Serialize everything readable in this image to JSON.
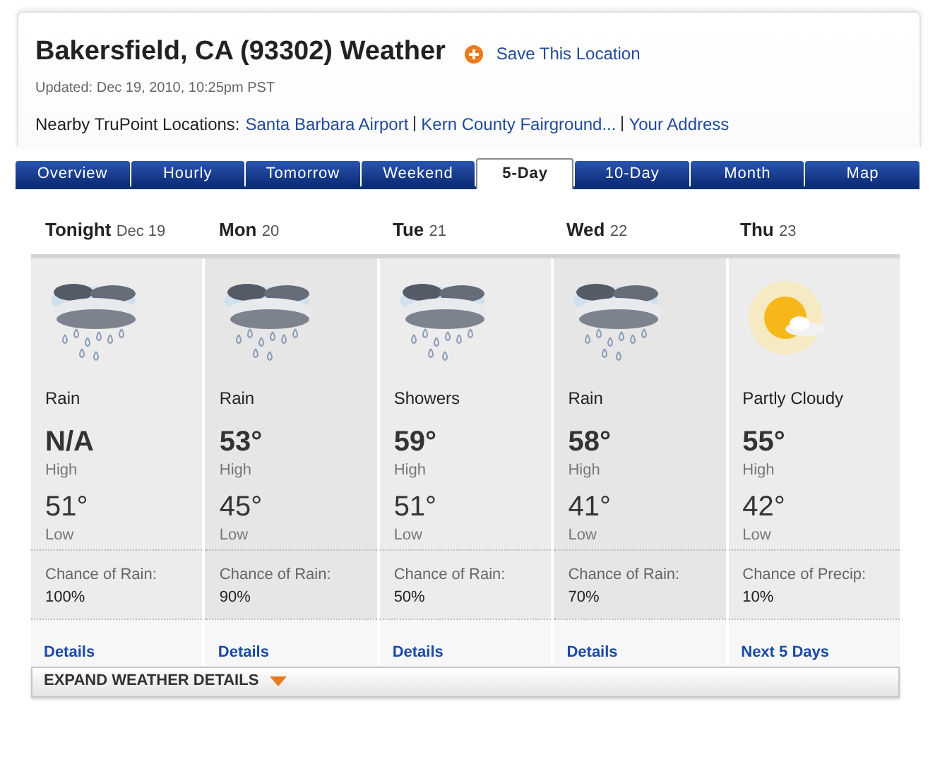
{
  "header": {
    "title": "Bakersfield, CA (93302) Weather",
    "save_link": "Save This Location",
    "updated": "Updated: Dec 19, 2010, 10:25pm PST",
    "nearby_label": "Nearby TruPoint Locations:",
    "nearby_links": [
      "Santa Barbara Airport",
      "Kern County Fairground...",
      "Your Address"
    ]
  },
  "tabs": [
    {
      "label": "Overview",
      "selected": false
    },
    {
      "label": "Hourly",
      "selected": false
    },
    {
      "label": "Tomorrow",
      "selected": false
    },
    {
      "label": "Weekend",
      "selected": false
    },
    {
      "label": "5-Day",
      "selected": true
    },
    {
      "label": "10-Day",
      "selected": false
    },
    {
      "label": "Month",
      "selected": false
    },
    {
      "label": "Map",
      "selected": false
    }
  ],
  "days": [
    {
      "day": "Tonight",
      "date": "Dec 19",
      "kind": "rain",
      "condition": "Rain",
      "high": "N/A",
      "high_label": "High",
      "low": "51°",
      "low_label": "Low",
      "chance_label": "Chance of Rain:",
      "chance": "100%",
      "link": "Details"
    },
    {
      "day": "Mon",
      "date": "20",
      "kind": "rain",
      "condition": "Rain",
      "high": "53°",
      "high_label": "High",
      "low": "45°",
      "low_label": "Low",
      "chance_label": "Chance of Rain:",
      "chance": "90%",
      "link": "Details"
    },
    {
      "day": "Tue",
      "date": "21",
      "kind": "rain",
      "condition": "Showers",
      "high": "59°",
      "high_label": "High",
      "low": "51°",
      "low_label": "Low",
      "chance_label": "Chance of Rain:",
      "chance": "50%",
      "link": "Details"
    },
    {
      "day": "Wed",
      "date": "22",
      "kind": "rain",
      "condition": "Rain",
      "high": "58°",
      "high_label": "High",
      "low": "41°",
      "low_label": "Low",
      "chance_label": "Chance of Rain:",
      "chance": "70%",
      "link": "Details"
    },
    {
      "day": "Thu",
      "date": "23",
      "kind": "partly_sunny",
      "condition": "Partly Cloudy",
      "high": "55°",
      "high_label": "High",
      "low": "42°",
      "low_label": "Low",
      "chance_label": "Chance of Precip:",
      "chance": "10%",
      "link": "Next 5 Days"
    }
  ],
  "expand": {
    "label": "EXPAND WEATHER DETAILS"
  }
}
